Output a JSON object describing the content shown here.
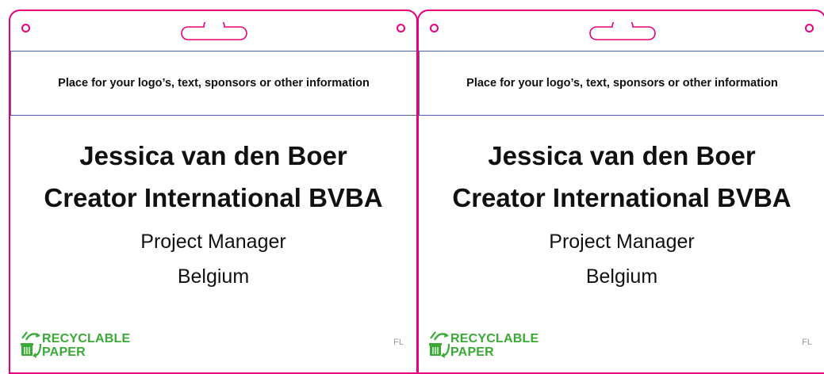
{
  "badges": [
    {
      "info_text": "Place for your logo’s, text, sponsors or other information",
      "name": "Jessica van den Boer",
      "company": "Creator International BVBA",
      "role": "Project Manager",
      "country": "Belgium",
      "recycle_line1": "RECYCLABLE",
      "recycle_line2": "PAPER",
      "mark": "FL"
    },
    {
      "info_text": "Place for your logo’s, text, sponsors or other information",
      "name": "Jessica van den Boer",
      "company": "Creator International BVBA",
      "role": "Project Manager",
      "country": "Belgium",
      "recycle_line1": "RECYCLABLE",
      "recycle_line2": "PAPER",
      "mark": "FL"
    }
  ],
  "colors": {
    "border": "#e6007e",
    "info_border": "#4a63a6",
    "recycle_green": "#3aa935"
  },
  "icons": [
    "punch-hole-icon",
    "hanger-slot-icon",
    "recycle-icon"
  ]
}
